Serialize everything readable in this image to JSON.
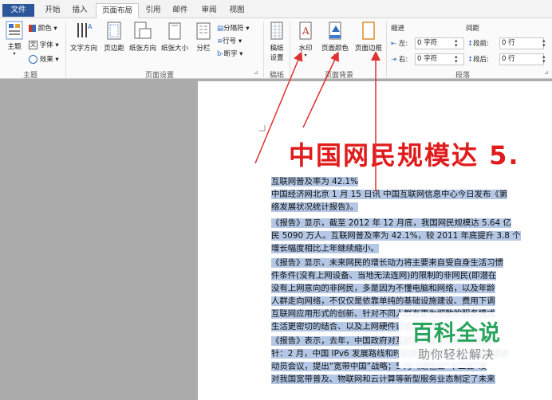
{
  "tabs": [
    "文件",
    "开始",
    "插入",
    "页面布局",
    "引用",
    "邮件",
    "审阅",
    "视图"
  ],
  "ribbon": {
    "theme": {
      "label": "主题",
      "colors": "颜色",
      "fonts": "字体",
      "effects": "效果",
      "group": "主题"
    },
    "page_setup": {
      "text_dir": "文字方向",
      "margins": "页边距",
      "orientation": "纸张方向",
      "size": "纸张大小",
      "columns": "分栏",
      "breaks": "分隔符",
      "line_numbers": "行号",
      "hyphenation": "断字",
      "group": "页面设置"
    },
    "manuscript": {
      "label1": "稿纸",
      "label2": "设置",
      "group": "稿纸"
    },
    "background": {
      "watermark": "水印",
      "page_color": "页面颜色",
      "page_border": "页面边框",
      "group": "页面背景"
    },
    "paragraph": {
      "indent": "缩进",
      "spacing": "间距",
      "left_label": "左:",
      "left_val": "0 字符",
      "right_label": "右:",
      "right_val": "0 字符",
      "before_label": "段前:",
      "before_val": "0 行",
      "after_label": "段后:",
      "after_val": "0 行",
      "group": "段落"
    }
  },
  "document": {
    "title": "中国网民规模达 5.",
    "lines": [
      "互联网普及率为 42.1%",
      "中国经济网北京 1 月 15 日讯  中国互联网信息中心今日发布《第",
      "络发展状况统计报告》。",
      "《报告》显示，截至 2012 年 12 月底，我国网民规模达 5.64 亿",
      "民 5090 万人。互联网普及率为 42.1%，较 2011 年底提升 3.8 个",
      "增长幅度相比上年继续缩小。",
      "《报告》显示，未来网民的增长动力将主要来自受自身生活习惯",
      "件条件(没有上网设备、当地无法连网)的限制的非网民(即潜在",
      "没有上网意向的非网民，多是因为不懂电脑和网络，以及年龄",
      "人群走向网络，不仅仅是依靠单纯的基础设施建设、费用下调",
      "互联网应用形式的创新、针对不同人群有更为细致的服务模式",
      "生活更密切的结合、以及上网硬件设备的便捷化。",
      "《报告》表示，去年，中国政府对互联网建设和互联网应用制",
      "针：2 月，中国 IPv6 发展路线和时间表确定；3 月，工信部组织",
      "动员会议，提出“宽带中国”战略；5 月《通信业“十二五”发",
      "对我国宽带普及、物联网和云计算等新型服务业态制定了未来"
    ]
  },
  "watermark": {
    "main": "百科全说",
    "sub": "助你轻松解决"
  },
  "colors": {
    "file_tab": "#2b579a",
    "title": "#e11b1b",
    "highlight": "#b4c8e6",
    "watermark_green": "#27a35b",
    "arrow": "#e03030"
  }
}
